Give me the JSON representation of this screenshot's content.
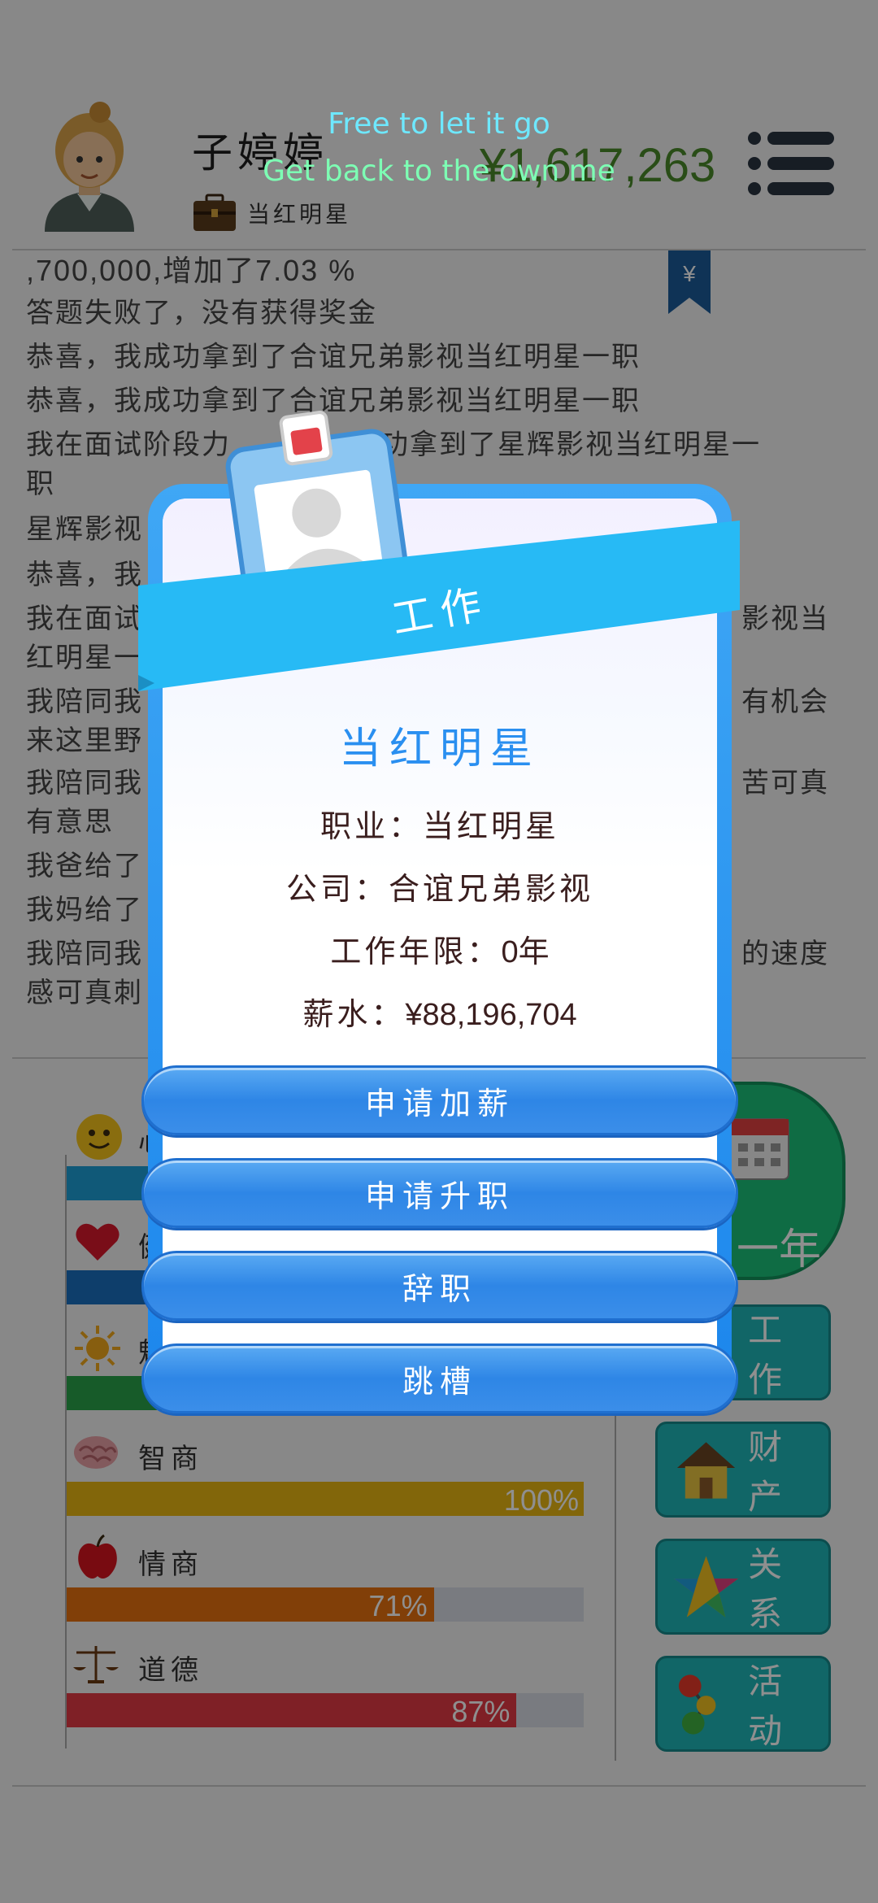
{
  "header": {
    "username": "子婷婷",
    "job": "当红明星",
    "money": "¥1,617,263",
    "lyric_line1": "Free to let it go",
    "lyric_line2": "Get back to the own me"
  },
  "log": {
    "lines": [
      ",700,000,增加了7.03 %",
      "答题失败了，没有获得奖金",
      "恭喜，我成功拿到了合谊兄弟影视当红明星一职",
      "恭喜，我成功拿到了合谊兄弟影视当红明星一职",
      "我在面试阶段力",
      "成功拿到了星辉影视当红明星一",
      "职",
      "星辉影视",
      "恭喜，我",
      "我在面试",
      "影视当",
      "红明星一",
      "我陪同我",
      "有机会",
      "来这里野",
      "我陪同我",
      "苦可真",
      "有意思",
      "我爸给了",
      "我妈给了",
      "我陪同我",
      "的速度",
      "感可真刺"
    ]
  },
  "stats": [
    {
      "label": "心",
      "value": 0.8,
      "color": "#1e9fd6",
      "text": ""
    },
    {
      "label": "健",
      "value": 0.8,
      "color": "#1a6fbf",
      "text": ""
    },
    {
      "label": "魅",
      "value": 0.8,
      "color": "#29a34a",
      "text": ""
    },
    {
      "label": "智商",
      "value": 1.0,
      "color": "#e8b613",
      "text": "100%"
    },
    {
      "label": "情商",
      "value": 0.71,
      "color": "#e6710f",
      "text": "71%"
    },
    {
      "label": "道德",
      "value": 0.87,
      "color": "#e23a44",
      "text": "87%"
    }
  ],
  "side": {
    "year": "一年",
    "work": "工作",
    "property": "财产",
    "relation": "关系",
    "activity": "活动"
  },
  "modal": {
    "title": "工作",
    "job_title": "当红明星",
    "occupation_label": "职业：",
    "occupation_value": "当红明星",
    "company_label": "公司：",
    "company_value": "合谊兄弟影视",
    "years_label": "工作年限：",
    "years_value": "0年",
    "salary_label": "薪水：",
    "salary_value": "¥88,196,704",
    "buttons": [
      "申请加薪",
      "申请升职",
      "辞职",
      "跳槽"
    ]
  },
  "colors": {
    "accent_blue": "#2a8ff0",
    "money_green": "#4a8a2a",
    "side_teal": "#1fb7b8"
  }
}
